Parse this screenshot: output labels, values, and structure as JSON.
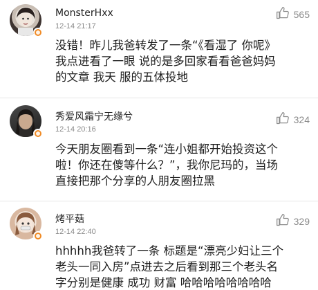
{
  "comments": [
    {
      "username": "MonsterHxx",
      "time": "12-14 21:17",
      "likes": "565",
      "lines": [
        "没错！昨儿我爸转发了一条“《看湿了 你呢》",
        "我点进看了一眼 说的是多回家看看爸爸妈妈",
        "的文章 我天 服的五体投地"
      ]
    },
    {
      "username": "秀爱风霜宁无缘兮",
      "time": "12-14 20:16",
      "likes": "324",
      "lines": [
        "今天朋友圈看到一条“连小姐都开始投资这个",
        "啦！你还在傻等什么？”，我你尼玛的，当场",
        "直接把那个分享的人朋友圈拉黑"
      ]
    },
    {
      "username": "烤平菇",
      "time": "12-14 22:40",
      "likes": "329",
      "lines": [
        "hhhhh我爸转了一条 标题是“漂亮少妇让三个",
        "老头一同入房”点进去之后看到那三个老头名",
        "字分别是健康 成功 财富 哈哈哈哈哈哈哈哈"
      ]
    }
  ],
  "colors": {
    "badge": "#f08a24",
    "meta": "#8a8a8a"
  },
  "icons": {
    "like": "thumbs-up-icon",
    "badge": "member-badge-icon"
  }
}
